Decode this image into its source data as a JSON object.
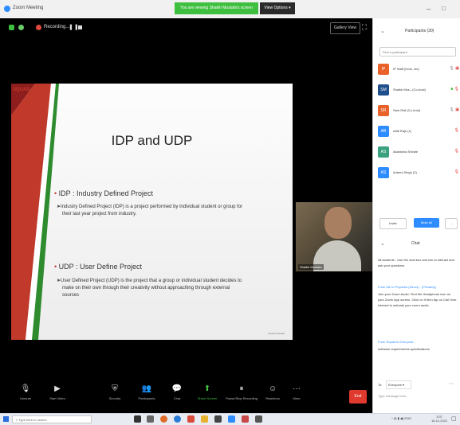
{
  "window": {
    "title": "Zoom Meeting",
    "share_banner": "You are viewing Shaikh Mustafa's screen",
    "view_options": "View Options",
    "minimize_glyph": "–",
    "maximize_glyph": "□"
  },
  "meeting": {
    "recording_label": "Recording...",
    "gallery_view": "Gallery View"
  },
  "slide": {
    "logo": "SQUAD",
    "title": "IDP and UDP",
    "bullet1": "IDP : Industry Defined Project",
    "desc1_line1": "Industry Defined Project (IDP) is a project performed by individual student or group for",
    "desc1_line2": "their last year project from industry.",
    "bullet2": "UDP : User Define Project",
    "desc2_line1": "User Defined Project (UDP) is the project that a group or individual student decides to",
    "desc2_line2": "make on their own through their creativity without approaching through external",
    "desc2_line3": "sources",
    "footer": "Shaikh Mustafa",
    "colors": {
      "red": "#c0392b",
      "green": "#2e8b2e"
    }
  },
  "speaker": {
    "name": "Shaikh Mustafa"
  },
  "toolbar": {
    "items": [
      {
        "label": "Unmute",
        "icon": "microphone-icon",
        "glyph": "🎙"
      },
      {
        "label": "Start Video",
        "icon": "video-camera-icon",
        "glyph": "▶"
      },
      {
        "label": "Security",
        "icon": "shield-icon",
        "glyph": "⛨"
      },
      {
        "label": "Participants",
        "icon": "people-icon",
        "glyph": "👥"
      },
      {
        "label": "Chat",
        "icon": "chat-icon",
        "glyph": "💬"
      },
      {
        "label": "Share Screen",
        "icon": "share-screen-icon",
        "glyph": "⬆"
      },
      {
        "label": "Pause/Stop Recording",
        "icon": "record-icon",
        "glyph": "⏸"
      },
      {
        "label": "Reactions",
        "icon": "reactions-icon",
        "glyph": "☺"
      },
      {
        "label": "More",
        "icon": "more-icon",
        "glyph": "···"
      }
    ],
    "end_label": "End"
  },
  "participants": {
    "title": "Participants (30)",
    "search_placeholder": "Find a participant",
    "list": [
      {
        "initials": "IP",
        "name": "IP Staff (Host, me)",
        "color": "#e8622a"
      },
      {
        "initials": "SM",
        "name": "Shaikh Mus...(Co-host)",
        "color": "#1f4e8c"
      },
      {
        "initials": "SR",
        "name": "Sam Roll (Co-host)",
        "color": "#e8622a"
      },
      {
        "initials": "AB",
        "name": "Aditi Raje (1)",
        "color": "#2d8cff"
      },
      {
        "initials": "AS",
        "name": "Akanksha Shinde",
        "color": "#3aa17e"
      },
      {
        "initials": "AS",
        "name": "Ankers Singh (2)",
        "color": "#2d8cff"
      }
    ],
    "invite": "Invite",
    "mute_all": "Mute All",
    "more": "..."
  },
  "chat": {
    "title": "Chat",
    "messages": [
      "All students - Use the chat box and mic to interact and ask your questions",
      "From Me to Priyanka (Direct) - (Privately)",
      "Join your Zoom Audio. Find the Headphone icon on your Zoom App screen. Click on it then tap on Call Over Internet to activate your zoom audio",
      "From Rupali to Everyone:",
      "software requirements specifications"
    ],
    "to_label": "To:",
    "to_value": "Everyone",
    "input_placeholder": "Type message here..."
  },
  "taskbar": {
    "search_placeholder": "Type here to search",
    "time": "3:37",
    "date": "16-11-2021"
  }
}
